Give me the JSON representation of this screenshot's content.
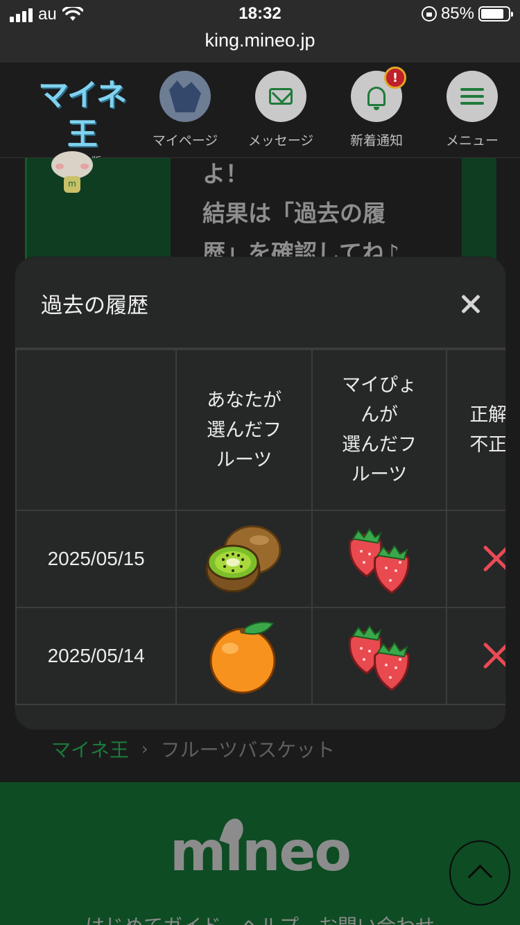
{
  "status_bar": {
    "carrier": "au",
    "time": "18:32",
    "battery_percent_text": "85%",
    "battery_level": 0.85
  },
  "browser": {
    "url": "king.mineo.jp"
  },
  "header": {
    "logo_text": "マイネ王",
    "logo_sub": "ベータ版",
    "nav": {
      "mypage": "マイページ",
      "message": "メッセージ",
      "notifications": "新着通知",
      "notification_badge": "!",
      "menu": "メニュー"
    }
  },
  "background": {
    "text": "よ！\n結果は「過去の履\n歴」を確認してね♪",
    "mascot_letter": "m"
  },
  "modal": {
    "title": "過去の履歴",
    "columns": [
      "",
      "あなたが\n選んだフ\nルーツ",
      "マイぴょ\nんが\n選んだフ\nルーツ",
      "正解\n不正"
    ],
    "rows": [
      {
        "date": "2025/05/15",
        "your_fruit": "kiwi-icon",
        "mypyon_fruit": "strawberry-icon",
        "result": "incorrect-x-icon"
      },
      {
        "date": "2025/05/14",
        "your_fruit": "orange-icon",
        "mypyon_fruit": "strawberry-icon",
        "result": "incorrect-x-icon"
      }
    ]
  },
  "breadcrumb": {
    "home": "マイネ王",
    "separator": "›",
    "current": "フルーツバスケット"
  },
  "footer": {
    "logo": "mineo",
    "links": "はじめてガイド　ヘルプ　お問い合わせ"
  },
  "colors": {
    "brand_green": "#1a7a3c",
    "modal_bg": "#262727",
    "wrong_red": "#ea4a55"
  }
}
